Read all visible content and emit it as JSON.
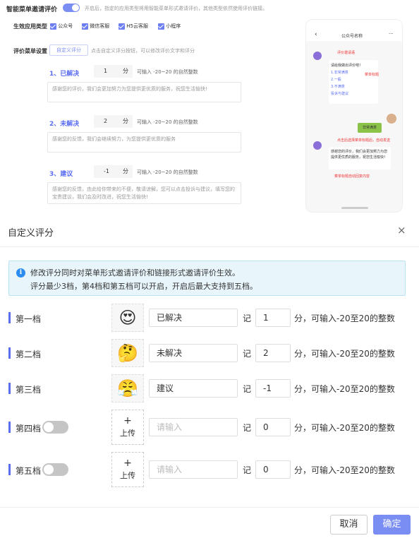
{
  "background": {
    "section_title": "智能菜单邀请评价",
    "section_desc": "开启后，指定的应用类型将用智能菜单形式邀请评价，其他类型依然使用评价链接。",
    "apply_label": "生效应用类型",
    "apply_types": [
      "公众号",
      "微信客服",
      "H5云客服",
      "小程序"
    ],
    "menu_label": "评价菜单设置",
    "custom_button": "自定义评分",
    "custom_hint": "点击自定义评分按钮，可以修改评价文字和评分",
    "options": [
      {
        "title": "1、已解决",
        "score": "1",
        "unit": "分",
        "hint": "可输入 -20~20 的自然整数",
        "text": "感谢您的评价，我们会更加努力为您提供更优质的服务，祝您生活愉快!"
      },
      {
        "title": "2、未解决",
        "score": "2",
        "unit": "分",
        "hint": "可输入 -20~20 的自然整数",
        "text": "感谢您的反馈，我们会继续努力，为您提供更优质的服务"
      },
      {
        "title": "3、建议",
        "score": "-1",
        "unit": "分",
        "hint": "可输入 -20~20 的自然整数",
        "text": "感谢您的反馈，由此给你带来的不便，敬请谅解，您可以点击投诉与建议，填写您的宝贵建议，我们会及时改进，祝您生活愉快!"
      }
    ],
    "phone": {
      "back": "‹",
      "title": "公众号名称",
      "dots": "···",
      "invite_label": "评价邀请语",
      "msg1": "请给我做出评价吧！",
      "menu_items": [
        "1.非常满意",
        "2.一般",
        "3.不满意",
        "投诉与建议"
      ],
      "menu_tag": "菜单标题",
      "user_reply": "非常满意",
      "auto_send_note": "点击后选择菜单标题后，自动发送",
      "reply_text": "感谢您的评价，我们会更加努力为您提供更优质的服务，祝您生活愉快！",
      "reply_note": "菜单标题自动回复内容"
    }
  },
  "dialog": {
    "title": "自定义评分",
    "close": "×",
    "notice_icon": "i",
    "notice_line1": "修改评分同时对菜单形式邀请评价和链接形式邀请评价生效。",
    "notice_line2": "评分最少3档，第4档和第五档可以开启，开启后最大支持到五档。",
    "rows": [
      {
        "name": "第一档",
        "emoji": "😍",
        "label": "已解决",
        "ji": "记",
        "score": "1",
        "hint": "分，可输入-20至20的整数"
      },
      {
        "name": "第二档",
        "emoji": "🤔",
        "label": "未解决",
        "ji": "记",
        "score": "2",
        "hint": "分，可输入-20至20的整数"
      },
      {
        "name": "第三档",
        "emoji": "😤",
        "label": "建议",
        "ji": "记",
        "score": "-1",
        "hint": "分，可输入-20至20的整数"
      },
      {
        "name": "第四档",
        "upload_plus": "+",
        "upload_text": "上传",
        "placeholder": "请输入",
        "ji": "记",
        "score": "0",
        "hint": "分，可输入-20至20的整数"
      },
      {
        "name": "第五档",
        "upload_plus": "+",
        "upload_text": "上传",
        "placeholder": "请输入",
        "ji": "记",
        "score": "0",
        "hint": "分，可输入-20至20的整数"
      }
    ],
    "cancel": "取消",
    "ok": "确定"
  },
  "colors": {
    "accent": "#7a8df3",
    "notice_bg": "#e8f6fc",
    "info": "#2d8cf0"
  }
}
